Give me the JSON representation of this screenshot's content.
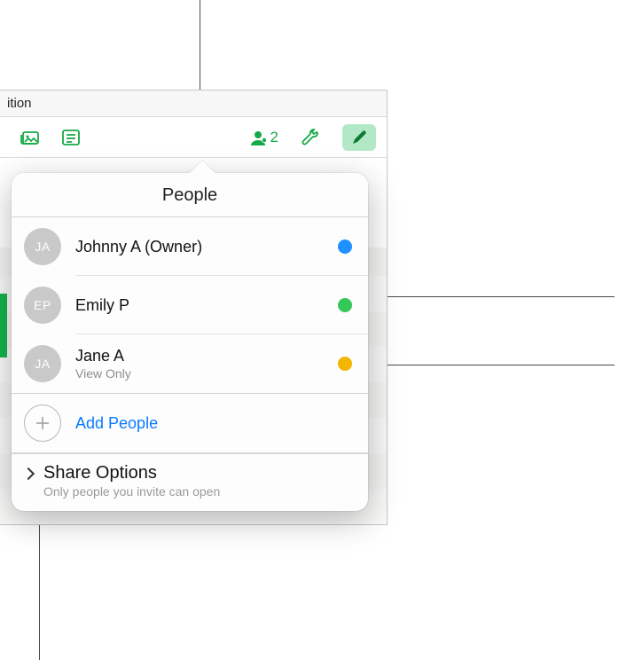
{
  "window": {
    "title_fragment": "ition"
  },
  "toolbar": {
    "share_count": "2"
  },
  "popover": {
    "title": "People",
    "people": [
      {
        "initials": "JA",
        "name": "Johnny A (Owner)",
        "sub": "",
        "dot": "#1e90ff"
      },
      {
        "initials": "EP",
        "name": "Emily P",
        "sub": "",
        "dot": "#34c759"
      },
      {
        "initials": "JA",
        "name": "Jane A",
        "sub": "View Only",
        "dot": "#f2b500"
      }
    ],
    "add_label": "Add People",
    "share_options": {
      "title": "Share Options",
      "subtitle": "Only people you invite can open"
    }
  },
  "colors": {
    "accent_green": "#17a948",
    "link_blue": "#0a7aff"
  }
}
